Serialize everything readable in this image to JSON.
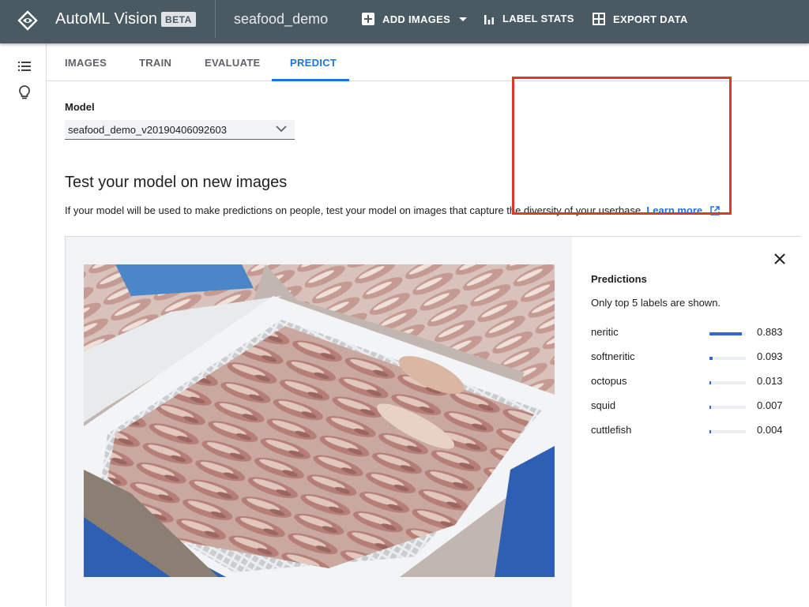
{
  "appbar": {
    "title": "AutoML Vision",
    "badge": "BETA",
    "dataset": "seafood_demo",
    "add_images": "ADD IMAGES",
    "label_stats": "LABEL STATS",
    "export_data": "EXPORT DATA",
    "bg_color": "#4a5a63"
  },
  "rail": {
    "icons": [
      "list-icon",
      "lightbulb-icon"
    ]
  },
  "tabs": [
    {
      "label": "IMAGES"
    },
    {
      "label": "TRAIN"
    },
    {
      "label": "EVALUATE"
    },
    {
      "label": "PREDICT",
      "active": true
    }
  ],
  "model": {
    "label": "Model",
    "selected": "seafood_demo_v20190406092603"
  },
  "section": {
    "title": "Test your model on new images",
    "description": "If your model will be used to make predictions on people, test your model on images that capture the diversity of your userbase.",
    "learn_more": "Learn more"
  },
  "predictions": {
    "title": "Predictions",
    "note": "Only top 5 labels are shown.",
    "items": [
      {
        "label": "neritic",
        "score": "0.883",
        "value": 0.883
      },
      {
        "label": "softneritic",
        "score": "0.093",
        "value": 0.093
      },
      {
        "label": "octopus",
        "score": "0.013",
        "value": 0.013
      },
      {
        "label": "squid",
        "score": "0.007",
        "value": 0.007
      },
      {
        "label": "cuttlefish",
        "score": "0.004",
        "value": 0.004
      }
    ],
    "highlight_color": "#d93a2a",
    "bar_color": "#3367d6"
  },
  "colors": {
    "accent": "#1a73e8"
  }
}
